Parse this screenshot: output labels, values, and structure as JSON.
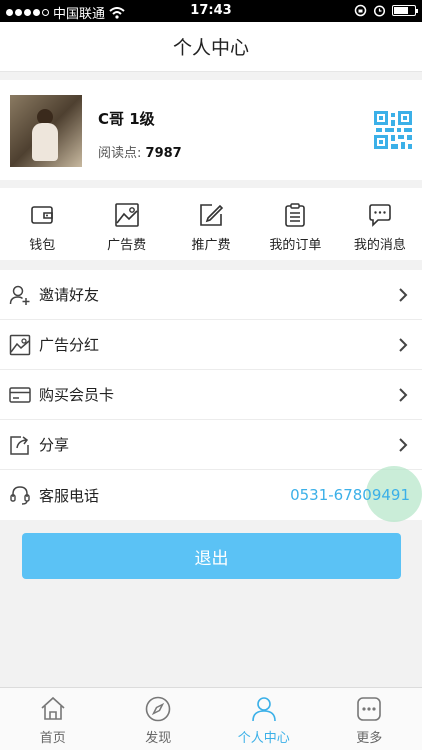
{
  "status_bar": {
    "carrier": "中国联通",
    "time": "17:43"
  },
  "navbar": {
    "title": "个人中心"
  },
  "profile": {
    "name": "C哥 1级",
    "points_label": "阅读点:",
    "points_value": "7987"
  },
  "shortcuts": [
    {
      "label": "钱包",
      "icon": "wallet-icon"
    },
    {
      "label": "广告费",
      "icon": "image-icon"
    },
    {
      "label": "推广费",
      "icon": "edit-icon"
    },
    {
      "label": "我的订单",
      "icon": "clipboard-icon"
    },
    {
      "label": "我的消息",
      "icon": "chat-icon"
    }
  ],
  "menu": [
    {
      "label": "邀请好友",
      "icon": "user-add-icon"
    },
    {
      "label": "广告分红",
      "icon": "image-icon"
    },
    {
      "label": "购买会员卡",
      "icon": "card-icon"
    },
    {
      "label": "分享",
      "icon": "share-icon"
    },
    {
      "label": "客服电话",
      "icon": "headset-icon",
      "value": "0531-67809491"
    }
  ],
  "logout_label": "退出",
  "tabs": [
    {
      "label": "首页",
      "icon": "home-icon",
      "active": false
    },
    {
      "label": "发现",
      "icon": "compass-icon",
      "active": false
    },
    {
      "label": "个人中心",
      "icon": "user-icon",
      "active": true
    },
    {
      "label": "更多",
      "icon": "more-icon",
      "active": false
    }
  ],
  "colors": {
    "accent": "#3bb0e8",
    "button": "#5bc2f5"
  }
}
